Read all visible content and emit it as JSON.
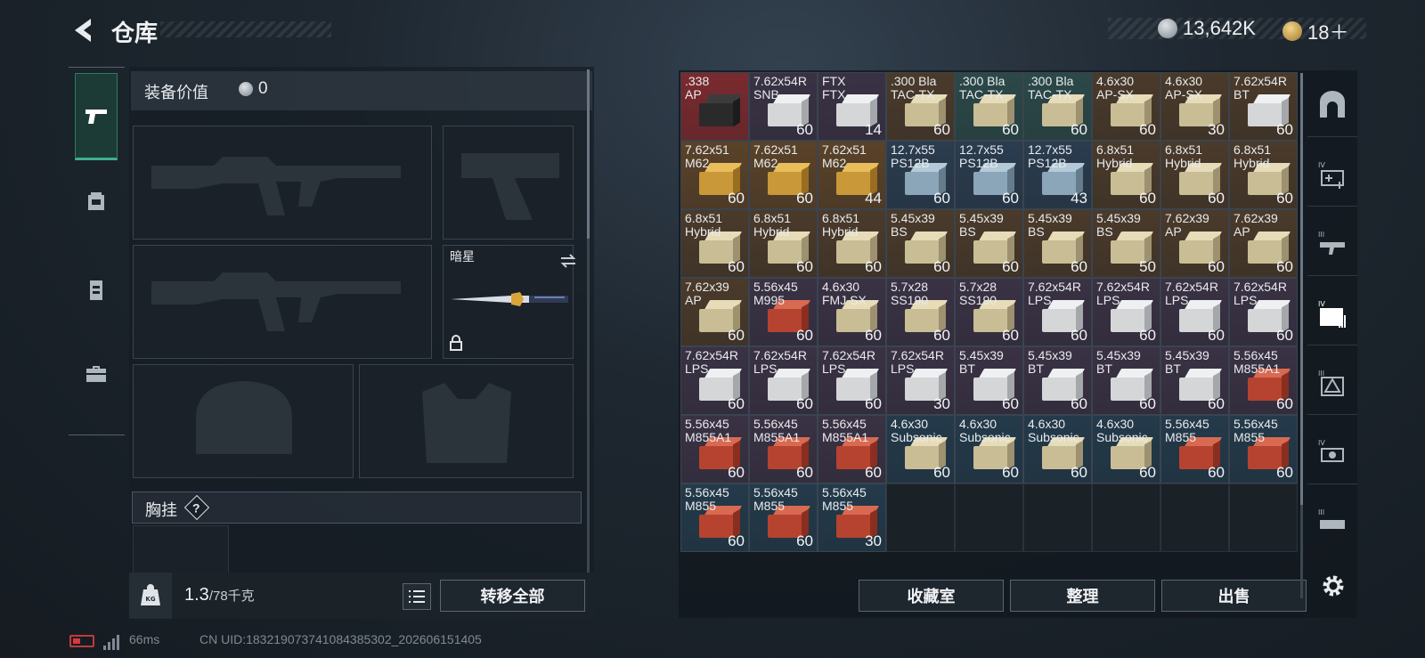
{
  "header": {
    "title": "仓库",
    "currency_silver": "13,642K",
    "currency_gold": "18＋"
  },
  "equipment": {
    "value_label": "装备价值",
    "value": "0",
    "melee_slot_name": "暗星",
    "chest_rig_label": "胸挂",
    "help_symbol": "?",
    "weight_current": "1.3",
    "weight_max": "/78千克",
    "transfer_all_label": "转移全部"
  },
  "stash": {
    "items": [
      {
        "name": ".338\nAP",
        "count": "",
        "color": "#7a2a2e"
      },
      {
        "name": "7.62x54R\nSNB",
        "count": "60",
        "color": "#3a3244"
      },
      {
        "name": "FTX\nFTX",
        "count": "14",
        "color": "#3a3244"
      },
      {
        "name": ".300 Bla\nTAC-TX",
        "count": "60",
        "color": "#4a3a2a"
      },
      {
        "name": ".300 Bla\nTAC-TX",
        "count": "60",
        "color": "#2c4848"
      },
      {
        "name": ".300 Bla\nTAC-TX",
        "count": "60",
        "color": "#2c4848"
      },
      {
        "name": "4.6x30\nAP-SX",
        "count": "60",
        "color": "#4a3a2a"
      },
      {
        "name": "4.6x30\nAP-SX",
        "count": "30",
        "color": "#4a3a2a"
      },
      {
        "name": "7.62x54R\nBT",
        "count": "60",
        "color": "#4a3a2a"
      },
      {
        "name": "7.62x51\nM62",
        "count": "60",
        "color": "#5a4228"
      },
      {
        "name": "7.62x51\nM62",
        "count": "60",
        "color": "#5a4228"
      },
      {
        "name": "7.62x51\nM62",
        "count": "44",
        "color": "#5a4228"
      },
      {
        "name": "12.7x55\nPS12B",
        "count": "60",
        "color": "#2a3c4e"
      },
      {
        "name": "12.7x55\nPS12B",
        "count": "60",
        "color": "#2a3c4e"
      },
      {
        "name": "12.7x55\nPS12B",
        "count": "43",
        "color": "#2a3c4e"
      },
      {
        "name": "6.8x51\nHybrid",
        "count": "60",
        "color": "#4a3a2a"
      },
      {
        "name": "6.8x51\nHybrid",
        "count": "60",
        "color": "#4a3a2a"
      },
      {
        "name": "6.8x51\nHybrid",
        "count": "60",
        "color": "#4a3a2a"
      },
      {
        "name": "6.8x51\nHybrid",
        "count": "60",
        "color": "#4a3a2a"
      },
      {
        "name": "6.8x51\nHybrid",
        "count": "60",
        "color": "#4a3a2a"
      },
      {
        "name": "6.8x51\nHybrid",
        "count": "60",
        "color": "#4a3a2a"
      },
      {
        "name": "5.45x39\nBS",
        "count": "60",
        "color": "#4a3a2a"
      },
      {
        "name": "5.45x39\nBS",
        "count": "60",
        "color": "#4a3a2a"
      },
      {
        "name": "5.45x39\nBS",
        "count": "60",
        "color": "#4a3a2a"
      },
      {
        "name": "5.45x39\nBS",
        "count": "50",
        "color": "#4a3a2a"
      },
      {
        "name": "7.62x39\nAP",
        "count": "60",
        "color": "#4a3a2a"
      },
      {
        "name": "7.62x39\nAP",
        "count": "60",
        "color": "#4a3a2a"
      },
      {
        "name": "7.62x39\nAP",
        "count": "60",
        "color": "#4a3a2a"
      },
      {
        "name": "5.56x45\nM995",
        "count": "60",
        "color": "#3a3244"
      },
      {
        "name": "4.6x30\nFMJ SX",
        "count": "60",
        "color": "#3a3244"
      },
      {
        "name": "5.7x28\nSS190",
        "count": "60",
        "color": "#3a3244"
      },
      {
        "name": "5.7x28\nSS190",
        "count": "60",
        "color": "#3a3244"
      },
      {
        "name": "7.62x54R\nLPS",
        "count": "60",
        "color": "#3a3244"
      },
      {
        "name": "7.62x54R\nLPS",
        "count": "60",
        "color": "#3a3244"
      },
      {
        "name": "7.62x54R\nLPS",
        "count": "60",
        "color": "#3a3244"
      },
      {
        "name": "7.62x54R\nLPS",
        "count": "60",
        "color": "#3a3244"
      },
      {
        "name": "7.62x54R\nLPS",
        "count": "60",
        "color": "#3a3244"
      },
      {
        "name": "7.62x54R\nLPS",
        "count": "60",
        "color": "#3a3244"
      },
      {
        "name": "7.62x54R\nLPS",
        "count": "60",
        "color": "#3a3244"
      },
      {
        "name": "7.62x54R\nLPS",
        "count": "30",
        "color": "#3a3244"
      },
      {
        "name": "5.45x39\nBT",
        "count": "60",
        "color": "#3a3244"
      },
      {
        "name": "5.45x39\nBT",
        "count": "60",
        "color": "#3a3244"
      },
      {
        "name": "5.45x39\nBT",
        "count": "60",
        "color": "#3a3244"
      },
      {
        "name": "5.45x39\nBT",
        "count": "60",
        "color": "#3a3244"
      },
      {
        "name": "5.56x45\nM855A1",
        "count": "60",
        "color": "#3a3244"
      },
      {
        "name": "5.56x45\nM855A1",
        "count": "60",
        "color": "#3a3244"
      },
      {
        "name": "5.56x45\nM855A1",
        "count": "60",
        "color": "#3a3244"
      },
      {
        "name": "5.56x45\nM855A1",
        "count": "60",
        "color": "#3a3244"
      },
      {
        "name": "4.6x30\nSubsonic",
        "count": "60",
        "color": "#243a4a"
      },
      {
        "name": "4.6x30\nSubsonic",
        "count": "60",
        "color": "#243a4a"
      },
      {
        "name": "4.6x30\nSubsonic",
        "count": "60",
        "color": "#243a4a"
      },
      {
        "name": "4.6x30\nSubsonic",
        "count": "60",
        "color": "#243a4a"
      },
      {
        "name": "5.56x45\nM855",
        "count": "60",
        "color": "#243a4a"
      },
      {
        "name": "5.56x45\nM855",
        "count": "60",
        "color": "#243a4a"
      },
      {
        "name": "5.56x45\nM855",
        "count": "60",
        "color": "#243a4a"
      },
      {
        "name": "5.56x45\nM855",
        "count": "60",
        "color": "#243a4a"
      },
      {
        "name": "5.56x45\nM855",
        "count": "30",
        "color": "#243a4a"
      }
    ],
    "empty_cells": 6,
    "collection_label": "收藏室",
    "sort_label": "整理",
    "sell_label": "出售"
  },
  "status_bar": {
    "ping": "66ms",
    "uid": "CN UID:183219073741084385302_202606151405"
  }
}
